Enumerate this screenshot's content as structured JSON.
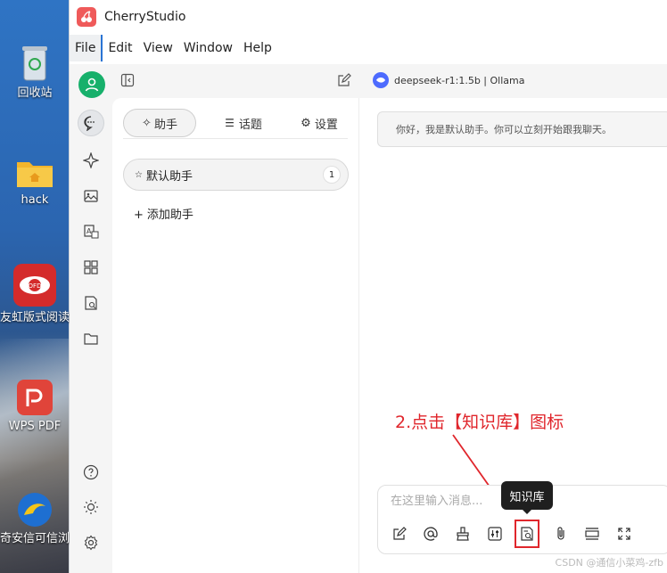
{
  "desktop": {
    "icons": [
      {
        "name": "recycle-bin-icon",
        "label": "回收站"
      },
      {
        "name": "folder-icon",
        "label": "hack"
      },
      {
        "name": "ofd-reader-icon",
        "label": "友虹版式阅读器"
      },
      {
        "name": "wps-pdf-icon",
        "label": "WPS PDF"
      },
      {
        "name": "browser-icon",
        "label": "奇安信可信浏览器"
      }
    ]
  },
  "window": {
    "title": "CherryStudio",
    "menu": [
      "File",
      "Edit",
      "View",
      "Window",
      "Help"
    ]
  },
  "header": {
    "model": "deepseek-r1:1.5b | Ollama"
  },
  "panel": {
    "tabs": [
      {
        "icon": "sparkle-icon",
        "label": "助手"
      },
      {
        "icon": "list-icon",
        "label": "话题"
      },
      {
        "icon": "gear-icon",
        "label": "设置"
      }
    ],
    "assistant": {
      "label": "默认助手",
      "count": "1"
    },
    "add_assistant": "添加助手"
  },
  "chat": {
    "greeting": "你好，我是默认助手。你可以立刻开始跟我聊天。",
    "input_placeholder": "在这里输入消息...",
    "tooltip": "知识库",
    "annotation": "2.点击【知识库】图标",
    "watermark": "CSDN @通信小菜鸡-zfb",
    "toolbar_icons": [
      "new-topic-icon",
      "mention-icon",
      "clear-icon",
      "settings-sliders-icon",
      "knowledge-base-icon",
      "attachment-icon",
      "divider-icon",
      "fullscreen-icon"
    ]
  },
  "colors": {
    "accent_green": "#17b06b",
    "annotation_red": "#e0262c",
    "model_blue": "#4d6bfe"
  }
}
